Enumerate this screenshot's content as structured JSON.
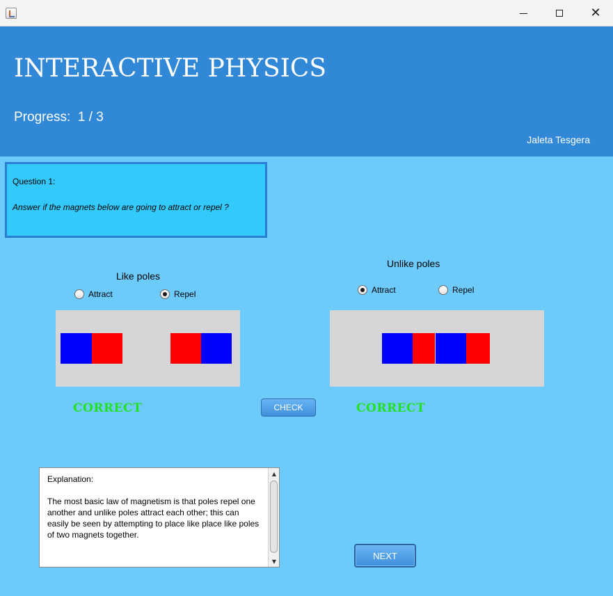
{
  "window": {
    "app_icon": "java-cup-icon",
    "minimize_icon": "minimize-icon",
    "maximize_icon": "maximize-icon",
    "close_glyph": "✕"
  },
  "header": {
    "title": "INTERACTIVE PHYSICS",
    "progress": "Progress:  1 / 3",
    "author": "Jaleta Tesgera",
    "background": "#3088d6"
  },
  "question": {
    "title": "Question 1:",
    "text": "Answer if the magnets below are going to attract or repel ?"
  },
  "like_poles": {
    "label": "Like poles",
    "options": [
      {
        "label": "Attract",
        "selected": false
      },
      {
        "label": "Repel",
        "selected": true
      }
    ],
    "result": "CORRECT"
  },
  "unlike_poles": {
    "label": "Unlike poles",
    "options": [
      {
        "label": "Attract",
        "selected": true
      },
      {
        "label": "Repel",
        "selected": false
      }
    ],
    "result": "CORRECT"
  },
  "buttons": {
    "check": "CHECK",
    "next": "NEXT"
  },
  "explanation": {
    "text": "Explanation:\n\nThe most basic law of magnetism is that poles repel one another and unlike poles attract each other; this can easily be seen by attempting to place like place like poles of two magnets together."
  },
  "colors": {
    "main_background": "#6ccbfb",
    "question_background": "#33c9fb",
    "magnet_north": "#0000ff",
    "magnet_south": "#ff0000",
    "correct_text": "#23e023"
  }
}
